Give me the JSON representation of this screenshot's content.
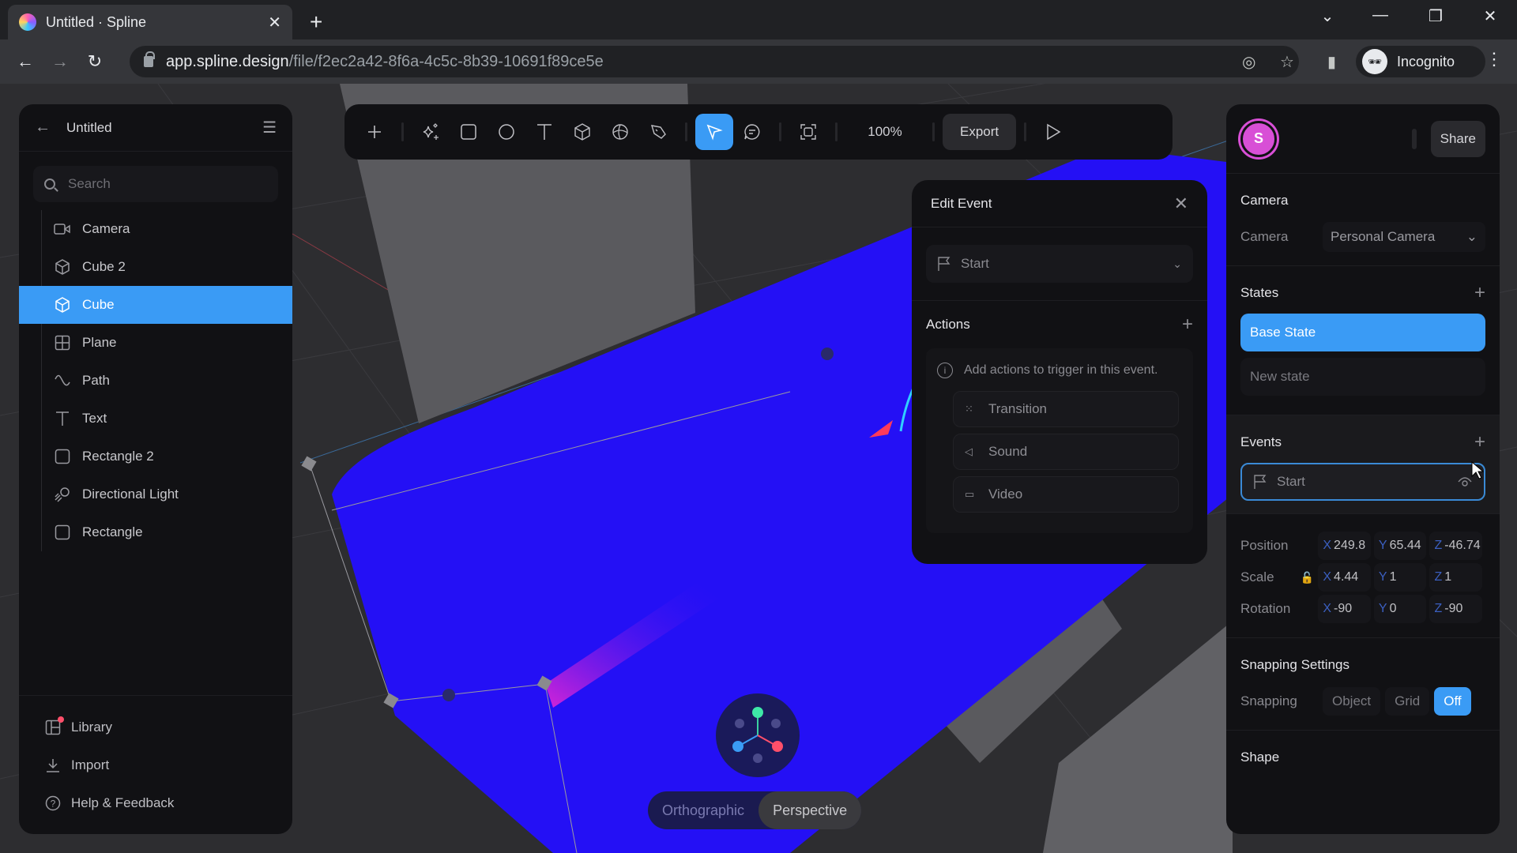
{
  "browser": {
    "tab_title": "Untitled · Spline",
    "url_host": "app.spline.design",
    "url_path": "/file/f2ec2a42-8f6a-4c5c-8b39-10691f89ce5e",
    "profile_label": "Incognito"
  },
  "left_panel": {
    "title": "Untitled",
    "search_placeholder": "Search",
    "items": [
      {
        "label": "Camera",
        "icon": "camera-icon",
        "selected": false
      },
      {
        "label": "Cube 2",
        "icon": "cube-icon",
        "selected": false
      },
      {
        "label": "Cube",
        "icon": "cube-icon",
        "selected": true
      },
      {
        "label": "Plane",
        "icon": "plane-icon",
        "selected": false
      },
      {
        "label": "Path",
        "icon": "path-icon",
        "selected": false
      },
      {
        "label": "Text",
        "icon": "text-icon",
        "selected": false
      },
      {
        "label": "Rectangle 2",
        "icon": "rectangle-icon",
        "selected": false
      },
      {
        "label": "Directional Light",
        "icon": "directional-light-icon",
        "selected": false
      },
      {
        "label": "Rectangle",
        "icon": "rectangle-icon",
        "selected": false
      }
    ],
    "footer": [
      {
        "label": "Library",
        "icon": "library-icon"
      },
      {
        "label": "Import",
        "icon": "import-icon"
      },
      {
        "label": "Help & Feedback",
        "icon": "help-icon"
      }
    ]
  },
  "toolbar": {
    "zoom": "100%",
    "export_label": "Export",
    "active_tool": "select"
  },
  "edit_event": {
    "title": "Edit Event",
    "event_type": "Start",
    "actions_title": "Actions",
    "hint": "Add actions to trigger in this event.",
    "actions": [
      {
        "label": "Transition",
        "icon": "transition-icon"
      },
      {
        "label": "Sound",
        "icon": "sound-icon"
      },
      {
        "label": "Video",
        "icon": "video-icon"
      }
    ]
  },
  "right_panel": {
    "avatar_initial": "S",
    "share_label": "Share",
    "camera_section": "Camera",
    "camera_label": "Camera",
    "camera_value": "Personal Camera",
    "states_title": "States",
    "states": [
      {
        "label": "Base State",
        "active": true
      },
      {
        "label": "New state",
        "active": false
      }
    ],
    "events_title": "Events",
    "events": [
      {
        "label": "Start"
      }
    ],
    "transform": {
      "position": {
        "label": "Position",
        "x": "249.8",
        "y": "65.44",
        "z": "-46.74"
      },
      "scale": {
        "label": "Scale",
        "x": "4.44",
        "y": "1",
        "z": "1"
      },
      "rotation": {
        "label": "Rotation",
        "x": "-90",
        "y": "0",
        "z": "-90"
      }
    },
    "snapping_title": "Snapping Settings",
    "snapping_label": "Snapping",
    "snapping_options": [
      "Object",
      "Grid",
      "Off"
    ],
    "snapping_selected": "Off",
    "shape_title": "Shape"
  },
  "viewport": {
    "projection_options": [
      "Orthographic",
      "Perspective"
    ],
    "projection_selected": "Perspective"
  },
  "colors": {
    "accent": "#3a9bf5",
    "object": "#2410f5",
    "avatar": "#d84fd6"
  }
}
